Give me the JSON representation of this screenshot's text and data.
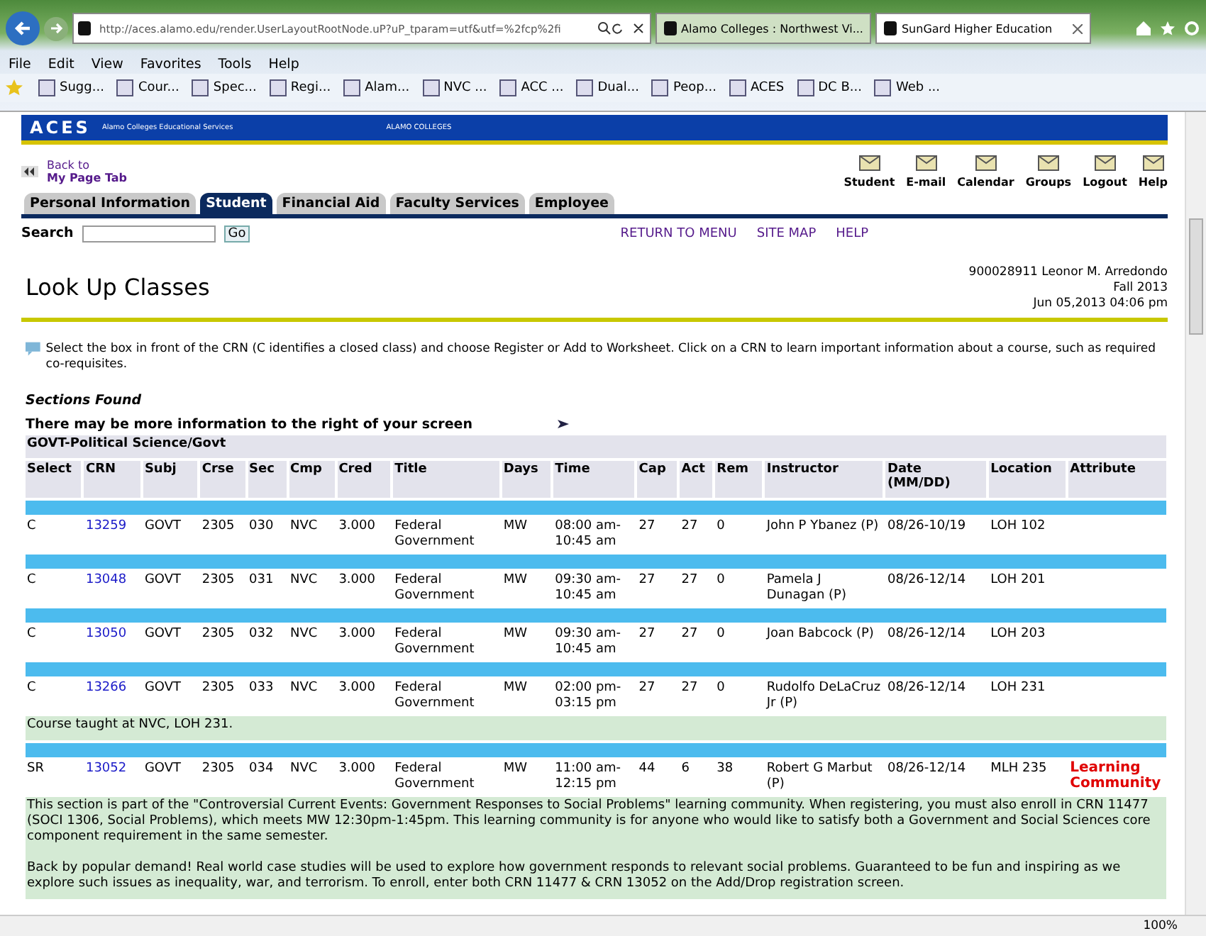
{
  "browser": {
    "url": "http://aces.alamo.edu/render.UserLayoutRootNode.uP?uP_tparam=utf&utf=%2fcp%2fi",
    "tabs": [
      {
        "title": "Alamo Colleges : Northwest Vi...",
        "selected": false
      },
      {
        "title": "SunGard Higher Education",
        "selected": true
      }
    ],
    "menu": [
      "File",
      "Edit",
      "View",
      "Favorites",
      "Tools",
      "Help"
    ],
    "favorites": [
      "Sugg...",
      "Cour...",
      "Spec...",
      "Regi...",
      "Alam...",
      "NVC ...",
      "ACC ...",
      "Dual...",
      "Peop...",
      "ACES",
      "DC B...",
      "Web ..."
    ]
  },
  "banner": {
    "logo": "ACES",
    "subtitle": "Alamo Colleges Educational Services",
    "college": "ALAMO COLLEGES"
  },
  "back_link": [
    "Back to",
    "My Page Tab"
  ],
  "toolbar": [
    "Student",
    "E-mail",
    "Calendar",
    "Groups",
    "Logout",
    "Help"
  ],
  "tabs": [
    {
      "label": "Personal Information",
      "selected": false
    },
    {
      "label": "Student",
      "selected": true
    },
    {
      "label": "Financial Aid",
      "selected": false
    },
    {
      "label": "Faculty Services",
      "selected": false
    },
    {
      "label": "Employee",
      "selected": false
    }
  ],
  "search": {
    "label": "Search",
    "button": "Go"
  },
  "nav_links": [
    "RETURN TO MENU",
    "SITE MAP",
    "HELP"
  ],
  "page_title": "Look Up Classes",
  "user_info": [
    "900028911 Leonor M. Arredondo",
    "Fall 2013",
    "Jun 05,2013 04:06 pm"
  ],
  "instructions": "Select the box in front of the CRN (C identifies a closed class) and choose Register or Add to Worksheet. Click on a CRN to learn important information about a course, such as required co-requisites.",
  "sections_heading": "Sections Found",
  "more_info": "There may be more information to the right of your screen",
  "subject": "GOVT-Political Science/Govt",
  "table": {
    "columns": [
      "Select",
      "CRN",
      "Subj",
      "Crse",
      "Sec",
      "Cmp",
      "Cred",
      "Title",
      "Days",
      "Time",
      "Cap",
      "Act",
      "Rem",
      "Instructor",
      "Date (MM/DD)",
      "Location",
      "Attribute"
    ],
    "rows": [
      {
        "select": "C",
        "crn": "13259",
        "subj": "GOVT",
        "crse": "2305",
        "sec": "030",
        "cmp": "NVC",
        "cred": "3.000",
        "title": "Federal Government",
        "days": "MW",
        "time": "08:00 am-10:45 am",
        "cap": "27",
        "act": "27",
        "rem": "0",
        "instructor": "John P Ybanez (P)",
        "date": "08/26-10/19",
        "location": "LOH 102",
        "notes": []
      },
      {
        "select": "C",
        "crn": "13048",
        "subj": "GOVT",
        "crse": "2305",
        "sec": "031",
        "cmp": "NVC",
        "cred": "3.000",
        "title": "Federal Government",
        "days": "MW",
        "time": "09:30 am-10:45 am",
        "cap": "27",
        "act": "27",
        "rem": "0",
        "instructor": "Pamela J Dunagan (P)",
        "date": "08/26-12/14",
        "location": "LOH 201",
        "notes": []
      },
      {
        "select": "C",
        "crn": "13050",
        "subj": "GOVT",
        "crse": "2305",
        "sec": "032",
        "cmp": "NVC",
        "cred": "3.000",
        "title": "Federal Government",
        "days": "MW",
        "time": "09:30 am-10:45 am",
        "cap": "27",
        "act": "27",
        "rem": "0",
        "instructor": "Joan Babcock (P)",
        "date": "08/26-12/14",
        "location": "LOH 203",
        "notes": []
      },
      {
        "select": "C",
        "crn": "13266",
        "subj": "GOVT",
        "crse": "2305",
        "sec": "033",
        "cmp": "NVC",
        "cred": "3.000",
        "title": "Federal Government",
        "days": "MW",
        "time": "02:00 pm-03:15 pm",
        "cap": "27",
        "act": "27",
        "rem": "0",
        "instructor": "Rudolfo DeLaCruz Jr (P)",
        "date": "08/26-12/14",
        "location": "LOH 231",
        "notes": [
          "Course taught at NVC, LOH 231."
        ]
      },
      {
        "select": "SR",
        "crn": "13052",
        "subj": "GOVT",
        "crse": "2305",
        "sec": "034",
        "cmp": "NVC",
        "cred": "3.000",
        "title": "Federal Government",
        "days": "MW",
        "time": "11:00 am-12:15 pm",
        "cap": "44",
        "act": "6",
        "rem": "38",
        "instructor": "Robert G Marbut (P)",
        "date": "08/26-12/14",
        "location": "MLH 235",
        "attribute": "Learning Community",
        "notes": [
          "This section is part of the \"Controversial Current Events: Government Responses to Social Problems\" learning community. When registering, you must also enroll in CRN 11477 (SOCI 1306, Social Problems), which meets MW 12:30pm-1:45pm. This learning community is for anyone who would like to satisfy both a Government and Social Sciences core component requirement in the same semester.",
          "Back by popular demand! Real world case studies will be used to explore how government responds to relevant social problems. Guaranteed to be fun and inspiring as we explore such issues as inequality, war, and terrorism. To enroll, enter both CRN 11477 & CRN 13052 on the Add/Drop registration screen."
        ]
      }
    ]
  },
  "status_bar": {
    "zoom": "100%"
  }
}
